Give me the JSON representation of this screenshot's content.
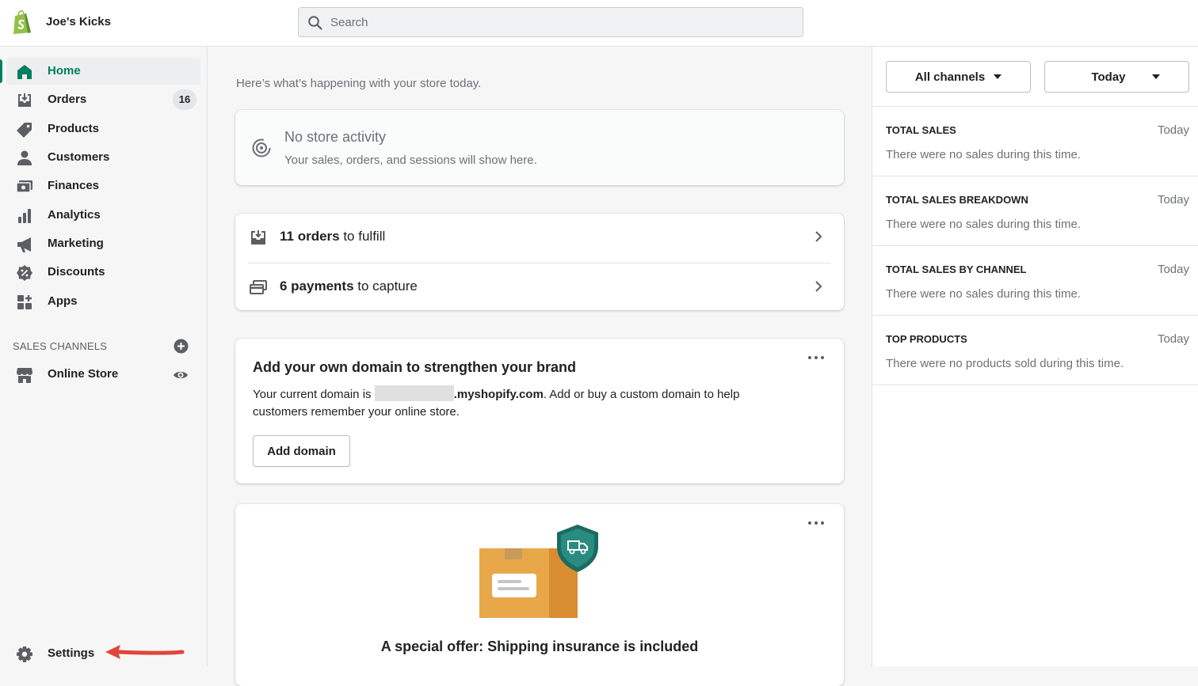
{
  "header": {
    "store_name": "Joe's Kicks",
    "search_placeholder": "Search"
  },
  "sidebar": {
    "items": [
      {
        "label": "Home",
        "icon": "home-icon",
        "active": true
      },
      {
        "label": "Orders",
        "icon": "orders-icon",
        "badge": "16"
      },
      {
        "label": "Products",
        "icon": "tag-icon"
      },
      {
        "label": "Customers",
        "icon": "person-icon"
      },
      {
        "label": "Finances",
        "icon": "finances-icon"
      },
      {
        "label": "Analytics",
        "icon": "bar-chart-icon"
      },
      {
        "label": "Marketing",
        "icon": "megaphone-icon"
      },
      {
        "label": "Discounts",
        "icon": "discount-icon"
      },
      {
        "label": "Apps",
        "icon": "apps-icon"
      }
    ],
    "sales_channels_heading": "SALES CHANNELS",
    "online_store_label": "Online Store",
    "settings_label": "Settings"
  },
  "main": {
    "subtitle": "Here’s what’s happening with your store today.",
    "activity": {
      "title": "No store activity",
      "subtitle": "Your sales, orders, and sessions will show here."
    },
    "tasks": {
      "orders_count": "11 orders",
      "orders_rest": " to fulfill",
      "payments_count": "6 payments",
      "payments_rest": " to capture"
    },
    "domain_card": {
      "title": "Add your own domain to strengthen your brand",
      "body_prefix": "Your current domain is ",
      "domain_suffix": ".myshopify.com",
      "body_suffix": ". Add or buy a custom domain to help customers remember your online store.",
      "button_label": "Add domain"
    },
    "offer_card": {
      "title": "A special offer: Shipping insurance is included"
    }
  },
  "right_panel": {
    "channels_label": "All channels",
    "period_label": "Today",
    "reports": [
      {
        "title": "TOTAL SALES",
        "period": "Today",
        "body": "There were no sales during this time."
      },
      {
        "title": "TOTAL SALES BREAKDOWN",
        "period": "Today",
        "body": "There were no sales during this time."
      },
      {
        "title": "TOTAL SALES BY CHANNEL",
        "period": "Today",
        "body": "There were no sales during this time."
      },
      {
        "title": "TOP PRODUCTS",
        "period": "Today",
        "body": "There were no products sold during this time."
      }
    ]
  },
  "colors": {
    "accent_green": "#008060",
    "annotation_arrow": "#e0463a"
  }
}
